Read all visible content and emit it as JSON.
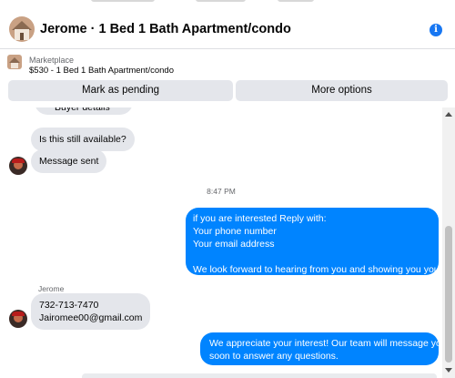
{
  "header": {
    "title": "Jerome · 1 Bed 1 Bath Apartment/condo",
    "info_icon": "i"
  },
  "marketplace": {
    "label": "Marketplace",
    "listing": "$530 - 1 Bed 1 Bath Apartment/condo"
  },
  "actions": {
    "pending_label": "Mark as pending",
    "more_label": "More options"
  },
  "conversation": {
    "cut_off_bubble": "Buyer details",
    "still_available": "Is this still available?",
    "message_sent": "Message sent",
    "timestamp": "8:47 PM",
    "reply_lines": [
      "if  you are interested  Reply with:",
      "Your phone number",
      "Your email address",
      "",
      "We look forward to hearing from you and showing you your"
    ],
    "sender_name": "Jerome",
    "contact_lines": [
      "732-713-7470",
      "Jairomee00@gmail.com"
    ],
    "auto_reply_lines": [
      "We appreciate your interest! Our team will message you",
      "soon to answer any questions."
    ]
  },
  "colors": {
    "accent": "#0084ff",
    "incoming_bubble": "#e4e6eb",
    "button_bg": "#e4e6eb",
    "info_blue": "#1877f2"
  }
}
